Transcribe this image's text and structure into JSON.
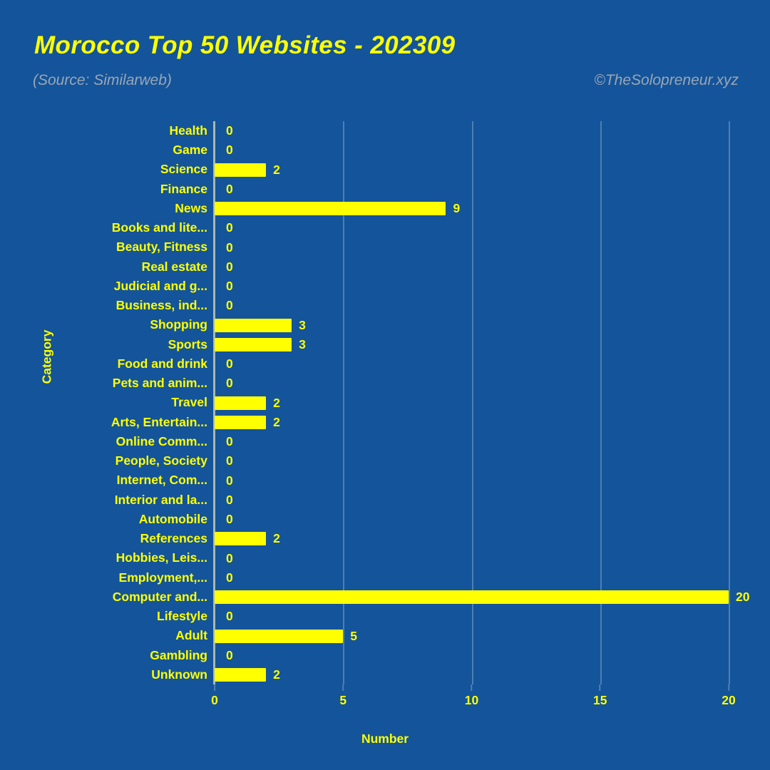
{
  "header": {
    "title": "Morocco Top 50 Websites - 202309",
    "subtitle": "(Source: Similarweb)",
    "watermark": "©TheSolopreneur.xyz"
  },
  "colors": {
    "background": "#14549a",
    "bar": "#ffff00",
    "text_accent": "#ffff00",
    "muted_text": "#9aa6b5",
    "gridline": "#4d7fb4",
    "axis_line": "#a8b8ae"
  },
  "chart_data": {
    "type": "bar",
    "orientation": "horizontal",
    "title": "Morocco Top 50 Websites - 202309",
    "subtitle": "(Source: Similarweb)",
    "xlabel": "Number",
    "ylabel": "Category",
    "xlim": [
      0,
      20
    ],
    "xticks": [
      "0",
      "5",
      "10",
      "15",
      "20"
    ],
    "xtick_values": [
      0,
      5,
      10,
      15,
      20
    ],
    "grid": true,
    "legend": null,
    "categories": [
      "Health",
      "Game",
      "Science",
      "Finance",
      "News",
      "Books and lite...",
      "Beauty, Fitness",
      "Real estate",
      "Judicial and g...",
      "Business, ind...",
      "Shopping",
      "Sports",
      "Food and drink",
      "Pets and anim...",
      "Travel",
      "Arts, Entertain...",
      "Online Comm...",
      "People, Society",
      "Internet, Com...",
      "Interior and la...",
      "Automobile",
      "References",
      "Hobbies, Leis...",
      "Employment,...",
      "Computer and...",
      "Lifestyle",
      "Adult",
      "Gambling",
      "Unknown"
    ],
    "values": [
      0,
      0,
      2,
      0,
      9,
      0,
      0,
      0,
      0,
      0,
      3,
      3,
      0,
      0,
      2,
      2,
      0,
      0,
      0,
      0,
      0,
      2,
      0,
      0,
      20,
      0,
      5,
      0,
      2
    ],
    "value_labels": [
      "0",
      "0",
      "2",
      "0",
      "9",
      "0",
      "0",
      "0",
      "0",
      "0",
      "3",
      "3",
      "0",
      "0",
      "2",
      "2",
      "0",
      "0",
      "0",
      "0",
      "0",
      "2",
      "0",
      "0",
      "20",
      "0",
      "5",
      "0",
      "2"
    ]
  }
}
